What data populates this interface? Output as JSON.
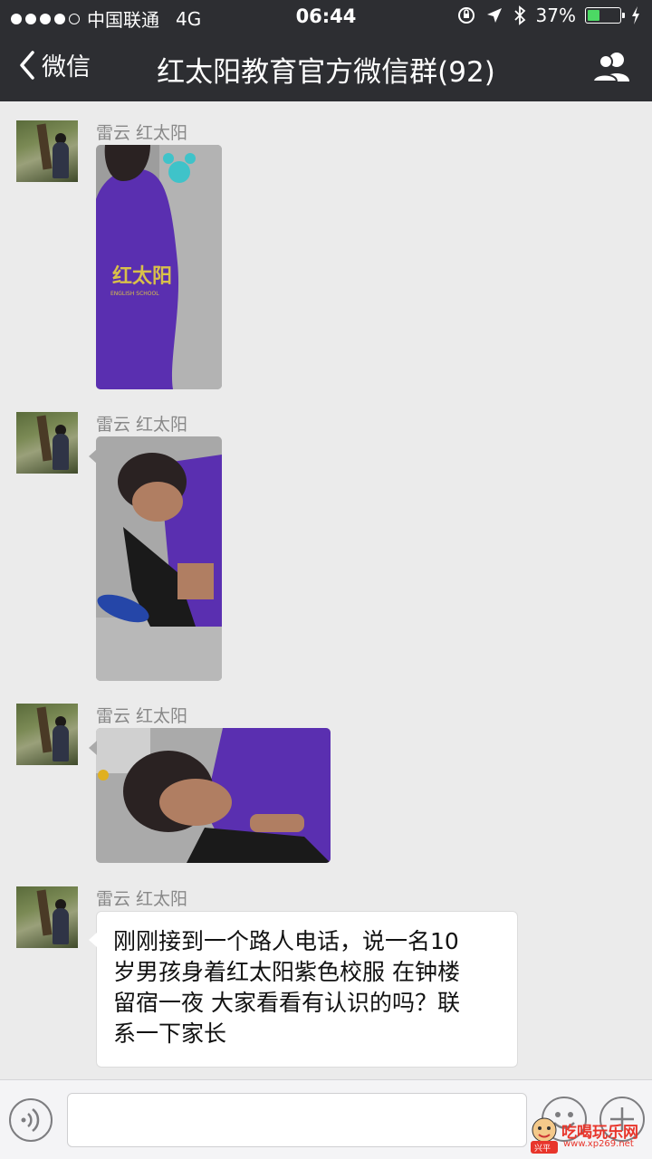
{
  "status_bar": {
    "carrier": "中国联通",
    "network": "4G",
    "time": "06:44",
    "battery": "37%",
    "battery_level": 0.37
  },
  "nav": {
    "back_label": "微信",
    "title": "红太阳教育官方微信群(92)",
    "group_icon": "group-members-icon"
  },
  "messages": [
    {
      "sender": "雷云 红太阳",
      "type": "image",
      "photo_text": "红太阳",
      "photo_subtext": "ENGLISH SCHOOL"
    },
    {
      "sender": "雷云 红太阳",
      "type": "image"
    },
    {
      "sender": "雷云 红太阳",
      "type": "image"
    },
    {
      "sender": "雷云 红太阳",
      "type": "text",
      "lines": [
        "刚刚接到一个路人电话，说一名10",
        "岁男孩身着红太阳紫色校服 在钟楼",
        "留宿一夜 大家看看有认识的吗？联",
        "系一下家长"
      ]
    }
  ],
  "input_bar": {
    "voice_icon": "voice-icon",
    "emoji_icon": "emoji-icon",
    "plus_icon": "plus-icon"
  },
  "watermark": {
    "badge": "兴平",
    "text": "吃喝玩乐网",
    "url": "www.xp269.net"
  },
  "colors": {
    "header_bg": "#2d2e32",
    "chat_bg": "#ebebeb",
    "uniform_purple": "#6a3fc0"
  }
}
